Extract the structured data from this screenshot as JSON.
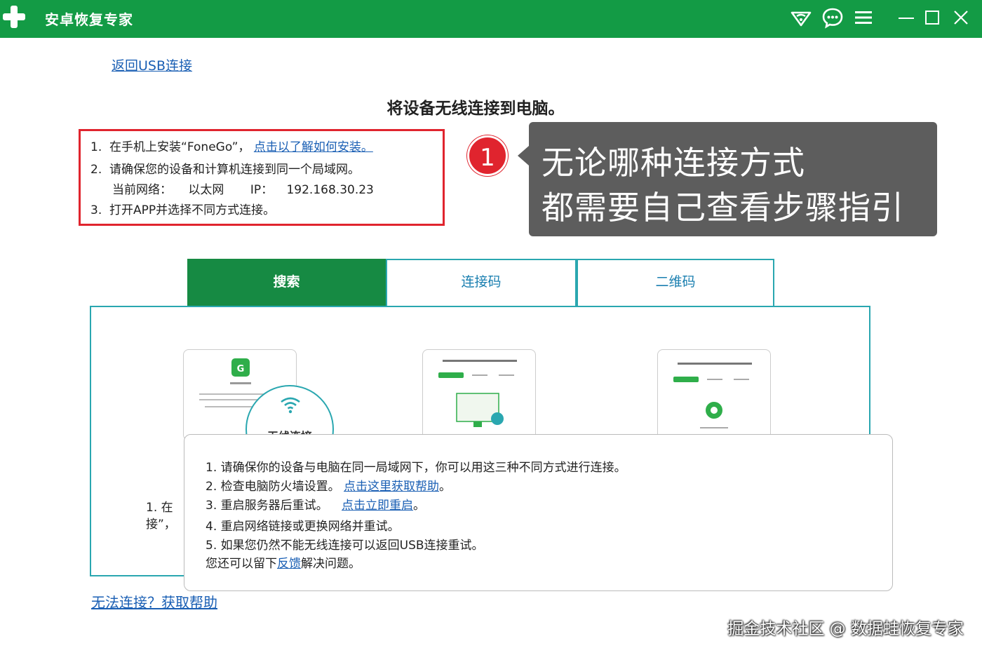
{
  "app": {
    "title": "安卓恢复专家",
    "brand_color": "#139b45"
  },
  "nav": {
    "back_link": "返回USB连接"
  },
  "page": {
    "title": "将设备无线连接到电脑。"
  },
  "steps": {
    "s1_num": "1.",
    "s1_text": "在手机上安装“FoneGo”，",
    "s1_link": "点击以了解如何安装。",
    "s2_num": "2.",
    "s2_text": "请确保您的设备和计算机连接到同一个局域网。",
    "network_label": "当前网络：",
    "network_value": "以太网",
    "ip_label": "IP：",
    "ip_value": "192.168.30.23",
    "s3_num": "3.",
    "s3_text": "打开APP并选择不同方式连接。"
  },
  "annotation": {
    "badge": "1",
    "line1": "无论哪种连接方式",
    "line2": "都需要自己查看步骤指引"
  },
  "tabs": [
    {
      "label": "搜索",
      "active": true
    },
    {
      "label": "连接码",
      "active": false
    },
    {
      "label": "二维码",
      "active": false
    }
  ],
  "wifi": {
    "label": "无线连接"
  },
  "left_fragment": {
    "line1": "1. 在",
    "line2": "接”，"
  },
  "troubleshoot": {
    "l1": "1.  请确保你的设备与电脑在同一局域网下，你可以用这三种不同方式进行连接。",
    "l2_text": "2.  检查电脑防火墙设置。",
    "l2_link": "点击这里获取帮助",
    "l2_end": "。",
    "l3_text": "3.  重启服务器后重试。",
    "l3_link": "点击立即重启",
    "l3_end": "。",
    "l4": "4.  重启网络链接或更换网络并重试。",
    "l5": "5.  如果您仍然不能无线连接可以返回USB连接重试。",
    "l6_text": "您还可以留下",
    "l6_link": "反馈",
    "l6_end": "解决问题。"
  },
  "footer": {
    "help_link": "无法连接？获取帮助",
    "watermark": "掘金技术社区 @ 数据蛙恢复专家"
  },
  "colors": {
    "accent_red": "#e0242e",
    "tab_border": "#2aa7b0",
    "link": "#1a5fb4",
    "callout_bg": "#5d5d5d"
  },
  "icons": [
    "plus-logo-icon",
    "wifi-share-icon",
    "chat-icon",
    "menu-icon",
    "minimize-icon",
    "maximize-icon",
    "close-icon",
    "wifi-icon"
  ]
}
